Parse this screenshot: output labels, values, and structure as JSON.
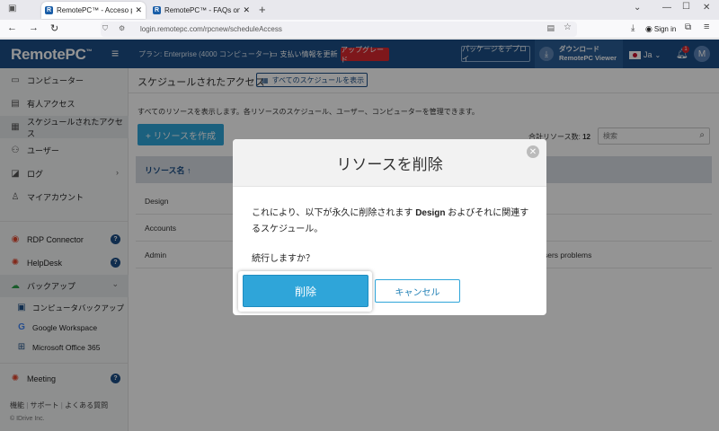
{
  "browser": {
    "tabs": [
      {
        "title": "RemotePC™ - Acceso programa",
        "active": true
      },
      {
        "title": "RemotePC™ - FAQs on RemoteP",
        "active": false
      }
    ],
    "new_tab": "+",
    "url": "login.remotepc.com/rpcnew/scheduleAccess",
    "sign_in": "Sign in"
  },
  "header": {
    "logo": "RemotePC",
    "logo_tm": "™",
    "plan": "プラン: Enterprise",
    "plan_detail": "(4000 コンピューター)",
    "billing": "支払い情報を更新",
    "upgrade": "アップグレード",
    "deploy": "パッケージをデプロイ",
    "download_line1": "ダウンロード",
    "download_line2": "RemotePC Viewer",
    "lang": "Ja",
    "avatar": "M",
    "notif_count": "1"
  },
  "sidebar": {
    "items": [
      {
        "label": "コンピューター"
      },
      {
        "label": "有人アクセス"
      },
      {
        "label": "スケジュールされたアクセス"
      },
      {
        "label": "ユーザー"
      },
      {
        "label": "ログ"
      },
      {
        "label": "マイアカウント"
      },
      {
        "label": "RDP Connector"
      },
      {
        "label": "HelpDesk"
      },
      {
        "label": "バックアップ"
      },
      {
        "label": "コンピュータバックアップ"
      },
      {
        "label": "Google Workspace"
      },
      {
        "label": "Microsoft Office 365"
      },
      {
        "label": "Meeting"
      }
    ],
    "footer_links": [
      "機能",
      "サポート",
      "よくある質問"
    ],
    "copyright": "© IDrive Inc."
  },
  "main": {
    "title": "スケジュールされたアクセス",
    "view_all": "すべてのスケジュールを表示",
    "description": "すべてのリソースを表示します。各リソースのスケジュール、ユーザー、コンピューターを管理できます。",
    "create_button": "+ リソースを作成",
    "total_label": "合計リソース数:",
    "total_value": "12",
    "search_placeholder": "検索",
    "column_header": "リソース名 ↑",
    "rows": [
      {
        "name": "Design",
        "extra": ""
      },
      {
        "name": "Accounts",
        "extra": ""
      },
      {
        "name": "Admin",
        "extra": "sers problems"
      }
    ]
  },
  "dialog": {
    "title": "リソースを削除",
    "message_pre": "これにより、以下が永久に削除されます ",
    "message_bold": "Design",
    "message_post": " およびそれに関連するスケジュール。",
    "confirm_question": "続行しますか？",
    "delete_label": "削除",
    "cancel_label": "キャンセル"
  }
}
